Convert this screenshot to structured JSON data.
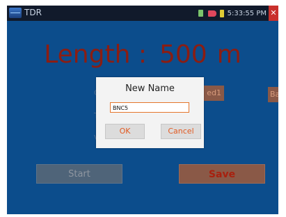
{
  "statusbar": {
    "title": "TDR",
    "app_icon": "tdr-app-icon",
    "indicator_icons": [
      "sd-card-icon",
      "usb-icon",
      "battery-icon"
    ],
    "time": "5:33:55 PM",
    "close_glyph": "✕"
  },
  "main": {
    "length_label": "Length :",
    "length_value": "500",
    "length_unit": "m",
    "side_labels": [
      "C",
      "T",
      "V"
    ],
    "named_button": "ed1",
    "back_button": "Bac",
    "start_button": "Start",
    "save_button": "Save"
  },
  "dialog": {
    "title": "New Name",
    "input_value": "BNC5",
    "ok_label": "OK",
    "cancel_label": "Cancel"
  },
  "colors": {
    "screen_bg": "#0c4d8c",
    "accent_orange": "#e25a22",
    "length_text": "#8b1d12"
  }
}
